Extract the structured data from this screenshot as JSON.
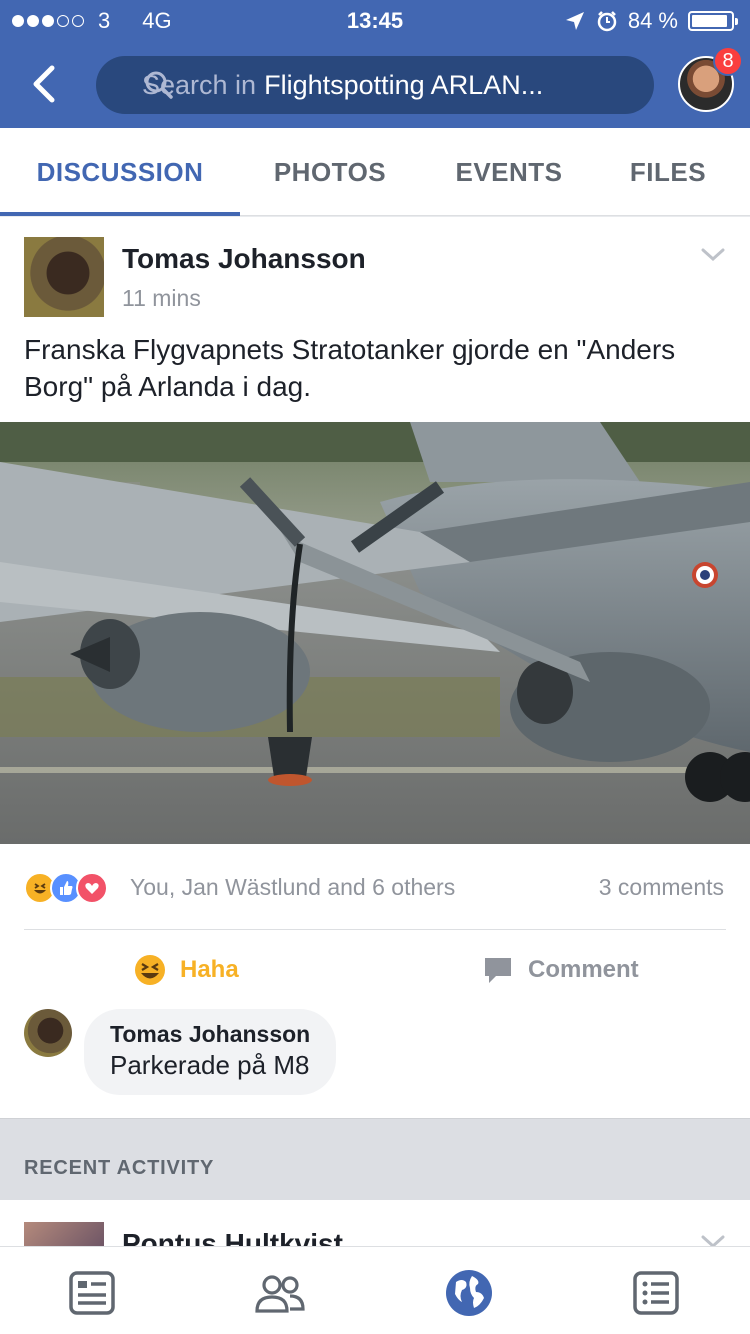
{
  "status_bar": {
    "signal_dots_filled": 3,
    "signal_dots_total": 5,
    "carrier": "3",
    "network": "4G",
    "time": "13:45",
    "battery": "84 %",
    "battery_level": 0.84,
    "icons": [
      "location-arrow-icon",
      "alarm-icon",
      "battery-icon"
    ]
  },
  "header": {
    "search_placeholder": "Search in",
    "search_group": "Flightspotting ARLAN...",
    "notification_count": "8",
    "accent_color": "#4267b2"
  },
  "tabs": [
    {
      "label": "DISCUSSION",
      "active": true
    },
    {
      "label": "PHOTOS",
      "active": false
    },
    {
      "label": "EVENTS",
      "active": false
    },
    {
      "label": "FILES",
      "active": false
    }
  ],
  "post": {
    "author": "Tomas Johansson",
    "time": "11 mins",
    "text": "Franska Flygvapnets Stratotanker gjorde en \"Anders Borg\" på Arlanda i dag.",
    "photo_icon": "aircraft-refueling-photo",
    "reactions": [
      "haha",
      "like",
      "love"
    ],
    "reactors": "You, Jan Wästlund and 6 others",
    "comments_count": "3 comments",
    "actions": {
      "haha_label": "Haha",
      "comment_label": "Comment"
    },
    "comment": {
      "author": "Tomas Johansson",
      "text": "Parkerade på M8"
    }
  },
  "recent_activity": {
    "title": "RECENT ACTIVITY",
    "first_author": "Pontus Hultkvist"
  },
  "bottom_nav": [
    "news-feed-icon",
    "groups-icon",
    "globe-icon",
    "menu-list-icon"
  ]
}
